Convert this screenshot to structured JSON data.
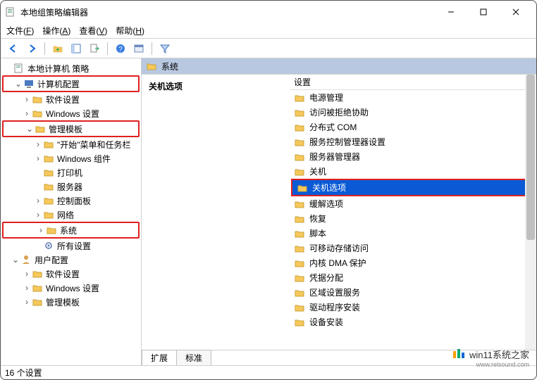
{
  "title": "本地组策略编辑器",
  "menus": {
    "file": "文件(F)",
    "action": "操作(A)",
    "view": "查看(V)",
    "help": "帮助(H)"
  },
  "tree": {
    "root": "本地计算机 策略",
    "n0": "计算机配置",
    "n0_0": "软件设置",
    "n0_1": "Windows 设置",
    "n0_2": "管理模板",
    "n0_2_0": "\"开始\"菜单和任务栏",
    "n0_2_1": "Windows 组件",
    "n0_2_2": "打印机",
    "n0_2_3": "服务器",
    "n0_2_4": "控制面板",
    "n0_2_5": "网络",
    "n0_2_6": "系统",
    "n0_2_7": "所有设置",
    "n1": "用户配置",
    "n1_0": "软件设置",
    "n1_1": "Windows 设置",
    "n1_2": "管理模板"
  },
  "right": {
    "header": "系统",
    "left_heading": "关机选项",
    "col": "设置",
    "items": [
      "电源管理",
      "访问被拒绝协助",
      "分布式 COM",
      "服务控制管理器设置",
      "服务器管理器",
      "关机",
      "关机选项",
      "缓解选项",
      "恢复",
      "脚本",
      "可移动存储访问",
      "内核 DMA 保护",
      "凭据分配",
      "区域设置服务",
      "驱动程序安装",
      "设备安装"
    ],
    "selected_index": 6
  },
  "tabs": {
    "ext": "扩展",
    "std": "标准"
  },
  "status": "16 个设置",
  "watermark": {
    "brand": "win11系统之家",
    "url": "www.relsound.com"
  }
}
